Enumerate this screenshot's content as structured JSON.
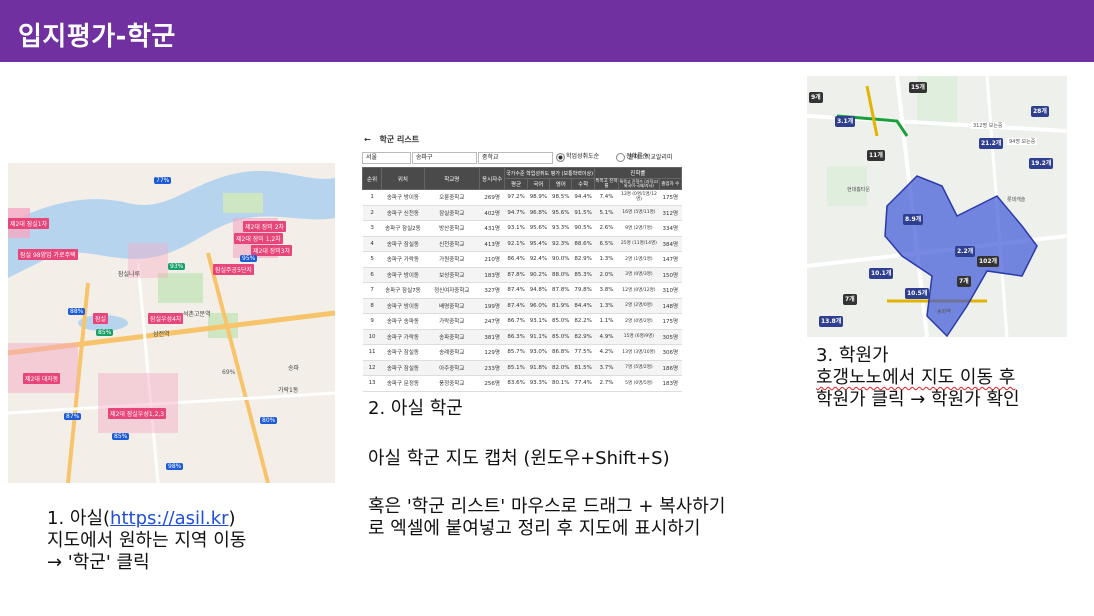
{
  "header": {
    "title": "입지평가-학군",
    "bg": "#7030a0"
  },
  "map1": {
    "labels": [
      "제2대 장미 2차",
      "제2대 장미 1,2차",
      "제2대 장미3차",
      "잠실주공5단지",
      "제2대 잠실1차",
      "잠실 98양입 가로주택",
      "잠실",
      "잠실우성4차",
      "제2대 대자동",
      "제2대 잠실우성1,2,3"
    ],
    "pcts": [
      "77%",
      "95%",
      "93%",
      "88%",
      "85%",
      "87%",
      "85%",
      "98%",
      "80%",
      "69%"
    ],
    "places": [
      "석촌고분역",
      "삼전역",
      "잠실나루",
      "송파",
      "가락1동"
    ]
  },
  "school_list": {
    "title": "학군 리스트",
    "filters": {
      "region": "서울",
      "district": "송파구",
      "level": "중학교",
      "sort_a": "학업성취도순",
      "sort_b": "진학률순",
      "source": "출처 : 학교알리미"
    },
    "group_header_a": "국가수준 학업성취도 평가 (보통학력이상)",
    "group_header_b": "진학률",
    "columns": [
      "순위",
      "위치",
      "학교명",
      "응시자수",
      "평균",
      "국어",
      "영어",
      "수학",
      "특목고 진학률",
      "특목고 진학수 (과학고/외국어·국제/자사)",
      "졸업자 수"
    ],
    "rows": [
      [
        "1",
        "송파구 방이동",
        "오륜중학교",
        "269명",
        "97.2%",
        "98.9%",
        "98.5%",
        "94.4%",
        "7.4%",
        "13명 (0명/1명/12명)",
        "175명"
      ],
      [
        "2",
        "송파구 신천동",
        "잠실중학교",
        "402명",
        "94.7%",
        "96.8%",
        "95.6%",
        "91.5%",
        "5.1%",
        "16명 (5명/11명)",
        "312명"
      ],
      [
        "3",
        "송파구 잠실2동",
        "방산중학교",
        "431명",
        "93.1%",
        "95.6%",
        "93.3%",
        "90.5%",
        "2.6%",
        "9명 (2명/7명)",
        "334명"
      ],
      [
        "4",
        "송파구 잠실동",
        "신천중학교",
        "413명",
        "92.1%",
        "95.4%",
        "92.3%",
        "88.6%",
        "6.5%",
        "25명 (11명/14명)",
        "384명"
      ],
      [
        "5",
        "송파구 가락동",
        "가원중학교",
        "210명",
        "86.4%",
        "92.4%",
        "90.0%",
        "82.9%",
        "1.3%",
        "2명 (1명/1명)",
        "147명"
      ],
      [
        "6",
        "송파구 방이동",
        "보성중학교",
        "183명",
        "87.8%",
        "90.2%",
        "88.0%",
        "85.3%",
        "2.0%",
        "3명 (0명/3명)",
        "150명"
      ],
      [
        "7",
        "송파구 잠실7동",
        "정신여자중학교",
        "327명",
        "87.4%",
        "94.8%",
        "87.8%",
        "79.8%",
        "3.8%",
        "12명 (0명/12명)",
        "310명"
      ],
      [
        "8",
        "송파구 방이동",
        "배명중학교",
        "199명",
        "87.4%",
        "96.0%",
        "81.9%",
        "84.4%",
        "1.3%",
        "2명 (2명/0명)",
        "148명"
      ],
      [
        "9",
        "송파구 송파동",
        "가락중학교",
        "247명",
        "86.7%",
        "93.1%",
        "85.0%",
        "82.2%",
        "1.1%",
        "2명 (0명/2명)",
        "175명"
      ],
      [
        "10",
        "송파구 가락동",
        "송파중학교",
        "381명",
        "86.3%",
        "91.1%",
        "85.0%",
        "82.9%",
        "4.9%",
        "15명 (6명/9명)",
        "305명"
      ],
      [
        "11",
        "송파구 잠실동",
        "송례중학교",
        "129명",
        "85.7%",
        "93.0%",
        "86.8%",
        "77.5%",
        "4.2%",
        "13명 (3명/10명)",
        "306명"
      ],
      [
        "12",
        "송파구 잠실동",
        "아주중학교",
        "233명",
        "85.1%",
        "91.8%",
        "82.0%",
        "81.5%",
        "3.7%",
        "7명 (5명/2명)",
        "186명"
      ],
      [
        "13",
        "송파구 문정동",
        "풍정중학교",
        "256명",
        "83.6%",
        "93.3%",
        "80.1%",
        "77.4%",
        "2.7%",
        "5명 (0명/5명)",
        "183명"
      ]
    ]
  },
  "map3": {
    "bubbles": [
      "15개",
      "28개",
      "21.2개",
      "9개",
      "3.1개",
      "11개",
      "19.2개",
      "8.9개",
      "10.1개",
      "2.2개",
      "102개",
      "7개",
      "10.5개",
      "7개",
      "13.8개"
    ],
    "labels": [
      "312명 보는중",
      "94명 보는중",
      "현대홈타운",
      "송파역",
      "롯데캐슬"
    ]
  },
  "captions": {
    "c1_prefix": "1. 아실(",
    "c1_link": "https://asil.kr",
    "c1_suffix": ")",
    "c1_line2": "지도에서 원하는 지역 이동",
    "c1_line3": "→ '학군' 클릭",
    "c2_line1": "2. 아실 학군",
    "c2_line2": "아실 학군 지도 캡처 (윈도우+Shift+S)",
    "c2_line3": "혹은 '학군 리스트' 마우스로 드래그 + 복사하기",
    "c2_line4": "로 엑셀에 붙여넣고 정리 후 지도에 표시하기",
    "c3_line1": "3. 학원가",
    "c3_line2": "호갱노노에서 지도 이동 후",
    "c3_line3": "학원가 클릭 → 학원가 확인"
  }
}
